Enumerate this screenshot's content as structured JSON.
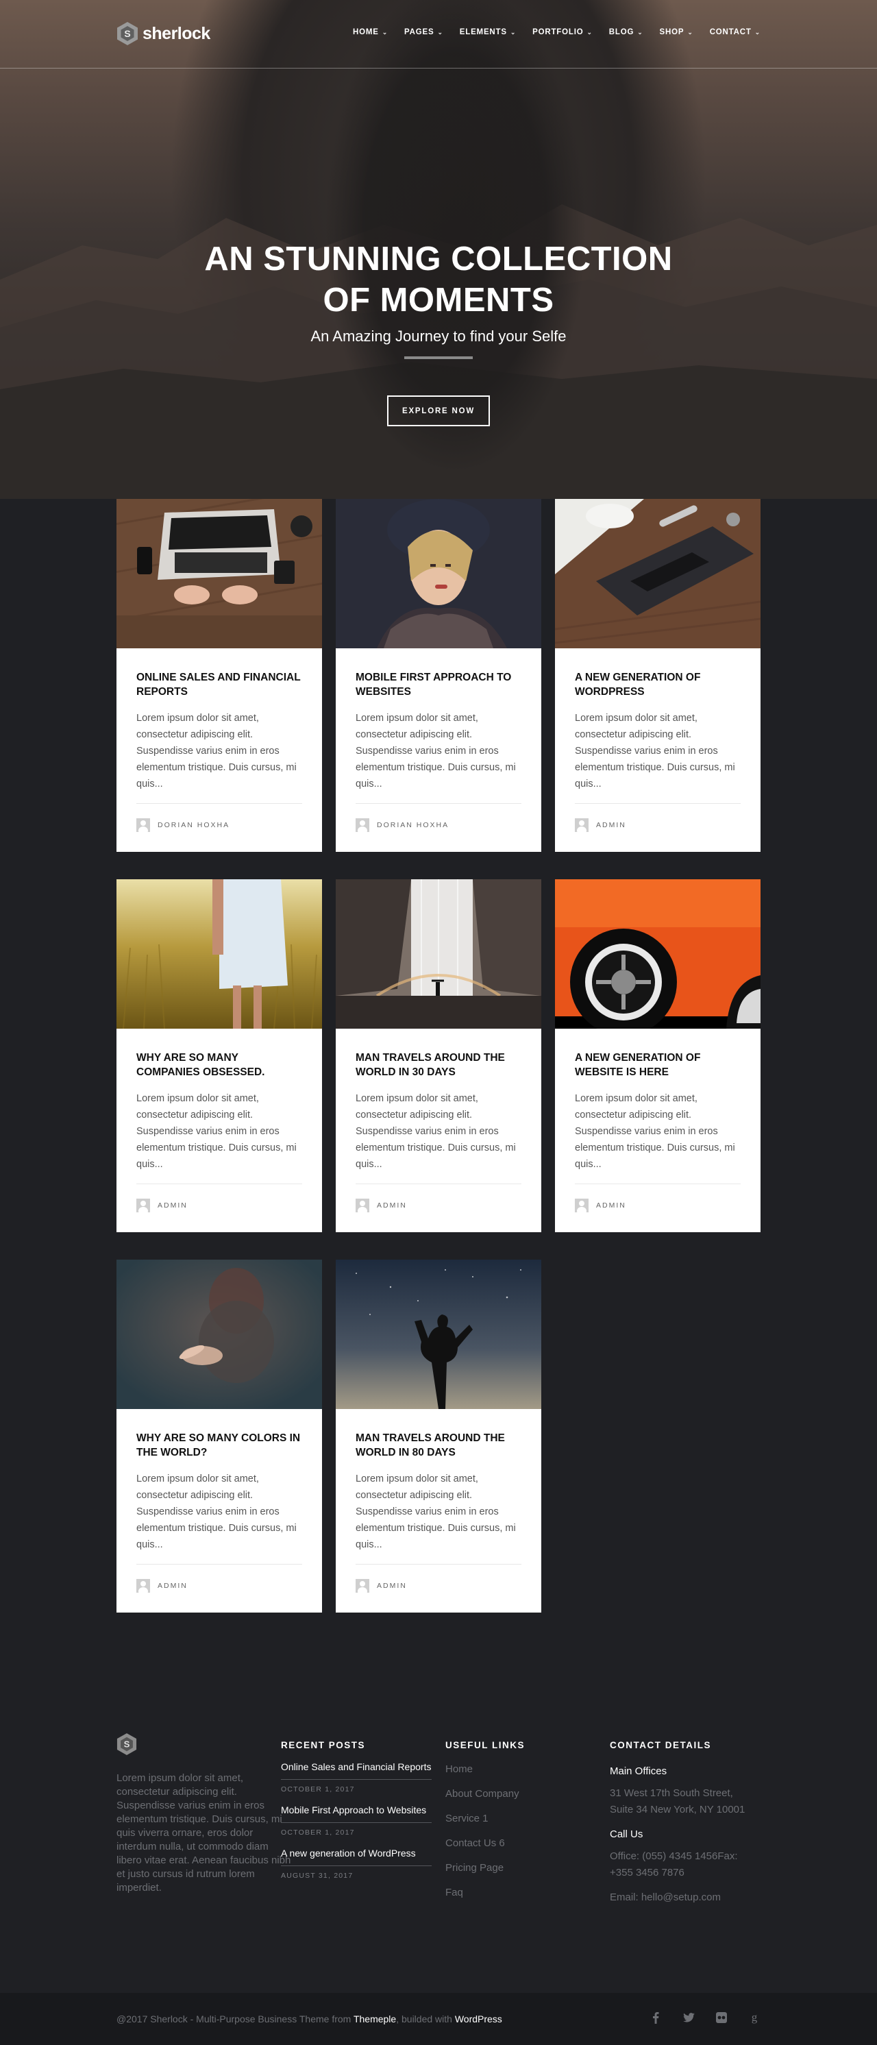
{
  "brand": {
    "name": "sherlock"
  },
  "nav": {
    "items": [
      {
        "label": "HOME"
      },
      {
        "label": "PAGES"
      },
      {
        "label": "ELEMENTS"
      },
      {
        "label": "PORTFOLIO"
      },
      {
        "label": "BLOG"
      },
      {
        "label": "SHOP"
      },
      {
        "label": "CONTACT"
      }
    ]
  },
  "hero": {
    "title_line1": "AN STUNNING COLLECTION",
    "title_line2": "OF MOMENTS",
    "subtitle": "An Amazing Journey to find your Selfe",
    "button": "EXPLORE NOW"
  },
  "posts": [
    {
      "title": "ONLINE SALES AND FINANCIAL REPORTS",
      "excerpt": "Lorem ipsum dolor sit amet, consectetur adipiscing elit. Suspendisse varius enim in eros elementum tristique. Duis cursus, mi quis...",
      "author": "DORIAN HOXHA",
      "image": "laptop-desk-photo"
    },
    {
      "title": "MOBILE FIRST APPROACH TO WEBSITES",
      "excerpt": "Lorem ipsum dolor sit amet, consectetur adipiscing elit. Suspendisse varius enim in eros elementum tristique. Duis cursus, mi quis...",
      "author": "DORIAN HOXHA",
      "image": "woman-fur-hat-photo"
    },
    {
      "title": "A NEW GENERATION OF WORDPRESS",
      "excerpt": "Lorem ipsum dolor sit amet, consectetur adipiscing elit. Suspendisse varius enim in eros elementum tristique. Duis cursus, mi quis...",
      "author": "ADMIN",
      "image": "desk-gadgets-photo"
    },
    {
      "title": "WHY ARE SO MANY COMPANIES OBSESSED.",
      "excerpt": "Lorem ipsum dolor sit amet, consectetur adipiscing elit. Suspendisse varius enim in eros elementum tristique. Duis cursus, mi quis...",
      "author": "ADMIN",
      "image": "wheat-field-photo"
    },
    {
      "title": "MAN TRAVELS AROUND THE WORLD IN 30 DAYS",
      "excerpt": "Lorem ipsum dolor sit amet, consectetur adipiscing elit. Suspendisse varius enim in eros elementum tristique. Duis cursus, mi quis...",
      "author": "ADMIN",
      "image": "waterfall-photo"
    },
    {
      "title": "A NEW GENERATION OF WEBSITE IS HERE",
      "excerpt": "Lorem ipsum dolor sit amet, consectetur adipiscing elit. Suspendisse varius enim in eros elementum tristique. Duis cursus, mi quis...",
      "author": "ADMIN",
      "image": "orange-car-photo"
    },
    {
      "title": "WHY ARE SO MANY COLORS IN THE WORLD?",
      "excerpt": "Lorem ipsum dolor sit amet, consectetur adipiscing elit. Suspendisse varius enim in eros elementum tristique. Duis cursus, mi quis...",
      "author": "ADMIN",
      "image": "blurred-hand-photo"
    },
    {
      "title": "MAN TRAVELS AROUND THE WORLD IN 80 DAYS",
      "excerpt": "Lorem ipsum dolor sit amet, consectetur adipiscing elit. Suspendisse varius enim in eros elementum tristique. Duis cursus, mi quis...",
      "author": "ADMIN",
      "image": "night-sky-silhouette-photo"
    }
  ],
  "footer": {
    "about": "Lorem ipsum dolor sit amet, consectetur adipiscing elit. Suspendisse varius enim in eros elementum tristique. Duis cursus, mi quis viverra ornare, eros dolor interdum nulla, ut commodo diam libero vitae erat. Aenean faucibus nibh et justo cursus id rutrum lorem imperdiet.",
    "recent_heading": "RECENT POSTS",
    "recent": [
      {
        "title": "Online Sales and Financial Reports",
        "date": "OCTOBER 1, 2017"
      },
      {
        "title": "Mobile First Approach to Websites",
        "date": "OCTOBER 1, 2017"
      },
      {
        "title": "A new generation of WordPress",
        "date": "AUGUST 31, 2017"
      }
    ],
    "links_heading": "USEFUL LINKS",
    "links": [
      "Home",
      "About Company",
      "Service 1",
      "Contact Us 6",
      "Pricing Page",
      "Faq"
    ],
    "contact_heading": "CONTACT DETAILS",
    "main_offices": "Main Offices",
    "address_line1": "31 West 17th South Street,",
    "address_line2": "Suite 34 New York, NY 10001",
    "call_us": "Call Us",
    "phone_line1": "Office: (055) 4345 1456Fax:",
    "phone_line2": "+355 3456 7876",
    "email": "Email: hello@setup.com"
  },
  "bottombar": {
    "copy_prefix": "@2017 Sherlock - Multi-Purpose Business Theme from ",
    "copy_themeple": "Themeple",
    "copy_mid": ", builded with ",
    "copy_wordpress": "WordPress",
    "socials": [
      "facebook-icon",
      "twitter-icon",
      "flickr-icon",
      "google-plus-icon"
    ]
  },
  "colors": {
    "background": "#1f2024",
    "card": "#ffffff",
    "accent_text": "#ffffff",
    "muted": "#6d6f74"
  }
}
